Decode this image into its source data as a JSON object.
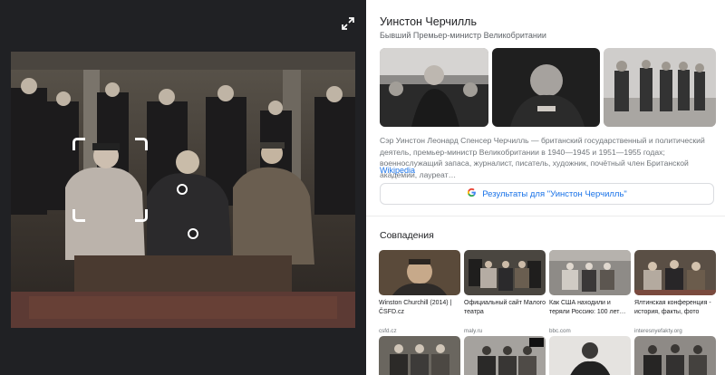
{
  "knowledge_panel": {
    "title": "Уинстон Черчилль",
    "subtitle": "Бывший Премьер-министр Великобритании",
    "description": "Сэр Уинстон Леонард Спенсер Черчилль — британский государственный и политический деятель, премьер-министр Великобритании в 1940—1945 и 1951—1955 годах; военнослужащий запаса, журналист, писатель, художник, почётный член Британской академии, лауреат…",
    "source_link": "Wikipedia",
    "results_button": "Результаты для \"Уинстон Черчилль\"",
    "images": [
      "photo-churchill-crowd",
      "photo-churchill-portrait",
      "photo-churchill-troops"
    ]
  },
  "matches": {
    "heading": "Совпадения",
    "items": [
      {
        "title": "Winston Churchill (2014) | ČSFD.cz",
        "source": "csfd.cz"
      },
      {
        "title": "Официальный сайт Малого театра",
        "source": "maly.ru"
      },
      {
        "title": "Как США находили и теряли Россию: 100 лет…",
        "source": "bbc.com"
      },
      {
        "title": "Ялтинская конференция - история, факты, фото",
        "source": "interesnyefakty.org"
      }
    ]
  },
  "icons": {
    "expand": "expand-icon",
    "google": "google-g-icon"
  },
  "colors": {
    "left_background": "#202124",
    "link": "#1a73e8",
    "title": "#202124",
    "secondary": "#5f6368",
    "google_blue": "#4285f4",
    "google_red": "#ea4335",
    "google_yellow": "#fbbc05",
    "google_green": "#34a853"
  }
}
